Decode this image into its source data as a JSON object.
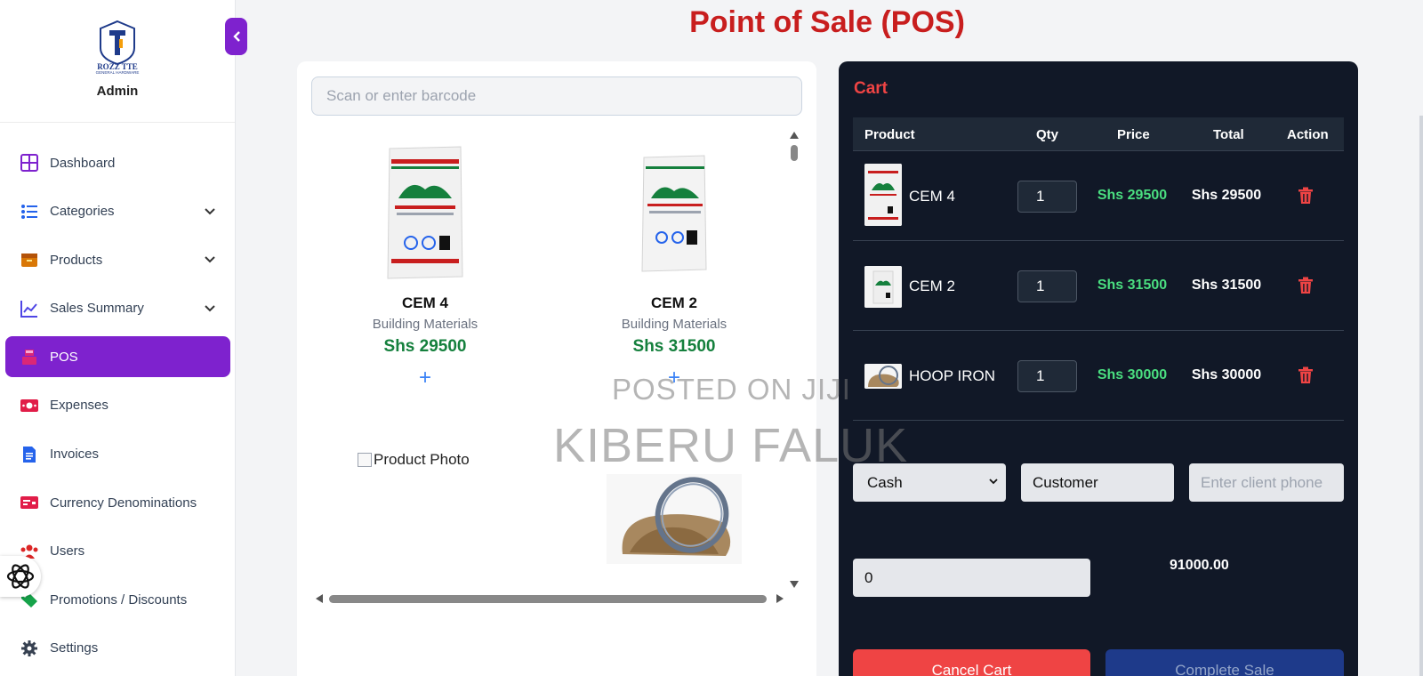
{
  "brand": {
    "name": "ROZZ TTE",
    "tagline": "GENERAL HARDWARE",
    "role": "Admin"
  },
  "sidebar": {
    "items": [
      {
        "label": "Dashboard",
        "icon": "dashboard-icon",
        "color": "#7e22ce",
        "has_chevron": false
      },
      {
        "label": "Categories",
        "icon": "list-icon",
        "color": "#2563eb",
        "has_chevron": true
      },
      {
        "label": "Products",
        "icon": "box-icon",
        "color": "#d97706",
        "has_chevron": true
      },
      {
        "label": "Sales Summary",
        "icon": "chart-line-icon",
        "color": "#4f46e5",
        "has_chevron": true
      },
      {
        "label": "POS",
        "icon": "cash-register-icon",
        "color": "#db2777",
        "has_chevron": false,
        "active": true
      },
      {
        "label": "Expenses",
        "icon": "money-bill-icon",
        "color": "#e11d48",
        "has_chevron": false
      },
      {
        "label": "Invoices",
        "icon": "file-invoice-icon",
        "color": "#2563eb",
        "has_chevron": false
      },
      {
        "label": "Currency Denominations",
        "icon": "money-card-icon",
        "color": "#e11d48",
        "has_chevron": false
      },
      {
        "label": "Users",
        "icon": "users-icon",
        "color": "#dc2626",
        "has_chevron": false
      },
      {
        "label": "Promotions / Discounts",
        "icon": "tags-icon",
        "color": "#16a34a",
        "has_chevron": false
      },
      {
        "label": "Settings",
        "icon": "gear-icon",
        "color": "#374151",
        "has_chevron": false
      }
    ]
  },
  "page": {
    "title": "Point of Sale (POS)"
  },
  "search": {
    "placeholder": "Scan or enter barcode"
  },
  "products": [
    {
      "name": "CEM 4",
      "category": "Building Materials",
      "price": "Shs 29500",
      "add": "+"
    },
    {
      "name": "CEM 2",
      "category": "Building Materials",
      "price": "Shs 31500",
      "add": "+"
    }
  ],
  "product_photo_alt": "Product Photo",
  "cart": {
    "title": "Cart",
    "headers": {
      "product": "Product",
      "qty": "Qty",
      "price": "Price",
      "total": "Total",
      "action": "Action"
    },
    "rows": [
      {
        "name": "CEM 4",
        "qty": "1",
        "price": "Shs 29500",
        "total": "Shs 29500"
      },
      {
        "name": "CEM 2",
        "qty": "1",
        "price": "Shs 31500",
        "total": "Shs 31500"
      },
      {
        "name": "HOOP IRON",
        "qty": "1",
        "price": "Shs 30000",
        "total": "Shs 30000"
      }
    ],
    "payment_method": "Cash",
    "customer": "Customer",
    "phone_placeholder": "Enter client phone",
    "amount": "0",
    "grand_total": "91000.00",
    "cancel_label": "Cancel Cart",
    "complete_label": "Complete Sale"
  },
  "watermark": {
    "line1": "POSTED ON JIJI",
    "line2": "KIBERU FALUK"
  },
  "colors": {
    "accent": "#7e22ce",
    "danger": "#ef4444",
    "price_green": "#15803d",
    "cart_bg": "#111827"
  }
}
